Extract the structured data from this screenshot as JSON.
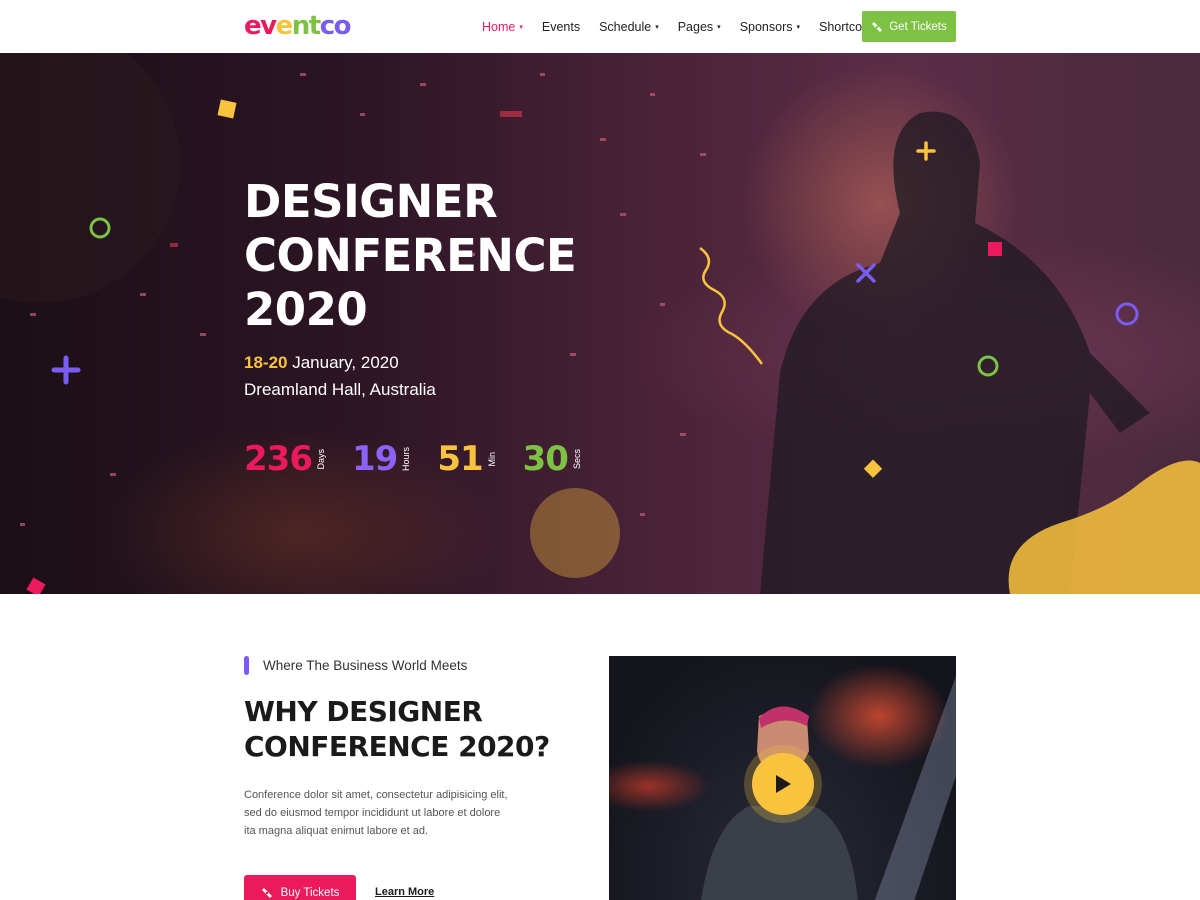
{
  "brand": {
    "letters": [
      "e",
      "v",
      "e",
      "n",
      "t",
      "c",
      "o"
    ],
    "letter_colors": [
      "#ec1a5c",
      "#ec1a5c",
      "#f9c33e",
      "#7dc244",
      "#7dc244",
      "#7b5cf3",
      "#7b5cf3"
    ]
  },
  "nav": {
    "items": [
      {
        "label": "Home",
        "dropdown": true,
        "active": true
      },
      {
        "label": "Events",
        "dropdown": false,
        "active": false
      },
      {
        "label": "Schedule",
        "dropdown": true,
        "active": false
      },
      {
        "label": "Pages",
        "dropdown": true,
        "active": false
      },
      {
        "label": "Sponsors",
        "dropdown": true,
        "active": false
      },
      {
        "label": "Shortcodes",
        "dropdown": true,
        "active": false
      }
    ],
    "caret": "▾",
    "cta_label": "Get Tickets",
    "cta_icon": "ticket-icon"
  },
  "hero": {
    "title_lines": [
      "DESIGNER",
      "CONFERENCE",
      "2020"
    ],
    "date_days": "18-20",
    "date_rest": " January, 2020",
    "venue": "Dreamland Hall, Australia",
    "countdown": [
      {
        "value": "236",
        "label": "Days",
        "color": "#ec1a5c"
      },
      {
        "value": "19",
        "label": "Hours",
        "color": "#8b62f5"
      },
      {
        "value": "51",
        "label": "Min",
        "color": "#f9c33e"
      },
      {
        "value": "30",
        "label": "Secs",
        "color": "#7dc244"
      }
    ]
  },
  "about": {
    "tagline": "Where The Business World Meets",
    "title_lines": [
      "WHY DESIGNER",
      "CONFERENCE 2020?"
    ],
    "body_lines": [
      "Conference dolor sit amet, consectetur adipisicing elit,",
      "sed do eiusmod tempor incididunt ut labore et dolore",
      "ita magna aliquat enimut labore et ad."
    ],
    "buy_label": "Buy Tickets",
    "learn_label": "Learn More",
    "video_icon": "play-icon"
  },
  "colors": {
    "pink": "#ec1a5c",
    "purple": "#7b5cf3",
    "yellow": "#f9c33e",
    "green": "#7dc244"
  }
}
